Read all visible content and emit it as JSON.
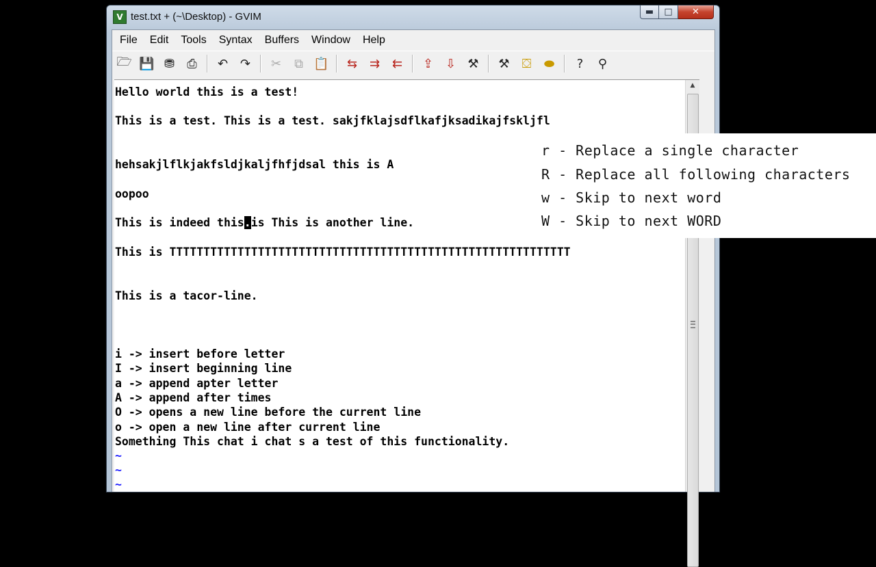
{
  "window": {
    "title": "test.txt + (~\\Desktop) - GVIM",
    "app_icon": "vim-icon",
    "controls": {
      "minimize": "▬",
      "maximize": "□",
      "close": "✕"
    }
  },
  "menu": [
    "File",
    "Edit",
    "Tools",
    "Syntax",
    "Buffers",
    "Window",
    "Help"
  ],
  "toolbar": [
    {
      "icon": "open-icon",
      "glyph": "🗁"
    },
    {
      "icon": "save-icon",
      "glyph": "💾"
    },
    {
      "icon": "save-all-icon",
      "glyph": "⛃"
    },
    {
      "icon": "print-icon",
      "glyph": "⎙"
    },
    {
      "icon": "undo-icon",
      "glyph": "↶"
    },
    {
      "icon": "redo-icon",
      "glyph": "↷"
    },
    {
      "icon": "cut-icon",
      "glyph": "✂"
    },
    {
      "icon": "copy-icon",
      "glyph": "⧉"
    },
    {
      "icon": "paste-icon",
      "glyph": "📋"
    },
    {
      "icon": "replace-icon",
      "glyph": "⇆"
    },
    {
      "icon": "find-next-icon",
      "glyph": "⇉"
    },
    {
      "icon": "find-prev-icon",
      "glyph": "⇇"
    },
    {
      "icon": "load-session-icon",
      "glyph": "⇪"
    },
    {
      "icon": "save-session-icon",
      "glyph": "⇩"
    },
    {
      "icon": "run-script-icon",
      "glyph": "⚒"
    },
    {
      "icon": "make-icon",
      "glyph": "⚒"
    },
    {
      "icon": "shell-icon",
      "glyph": "⛋"
    },
    {
      "icon": "tag-icon",
      "glyph": "⬬"
    },
    {
      "icon": "help-icon",
      "glyph": "?"
    },
    {
      "icon": "find-help-icon",
      "glyph": "⚲"
    }
  ],
  "editor": {
    "lines": [
      {
        "text": "Hello world this is a test!",
        "row": 0
      },
      {
        "text": "This is a test. This is a test. sakjfklajsdflkafjksadikajfskljfl",
        "row": 2
      },
      {
        "text": "hehsakjlflkjakfsldjkaljfhfjdsal this is A",
        "row": 5
      },
      {
        "text": "oopoo",
        "row": 7
      },
      {
        "before": "This is indeed this",
        "cursor": ".",
        "after": "is This is another line.",
        "row": 9
      },
      {
        "text": "This is TTTTTTTTTTTTTTTTTTTTTTTTTTTTTTTTTTTTTTTTTTTTTTTTTTTTTTTTTTT",
        "row": 11
      },
      {
        "text": "This is a tacor-line.",
        "row": 14
      },
      {
        "text": "i -> insert before letter",
        "row": 18
      },
      {
        "text": "I -> insert beginning line",
        "row": 19
      },
      {
        "text": "a -> append apter letter",
        "row": 20
      },
      {
        "text": "A -> append after times",
        "row": 21
      },
      {
        "text": "O -> opens a new line before the current line",
        "row": 22
      },
      {
        "text": "o -> open a new line after current line",
        "row": 23
      },
      {
        "text": "Something This chat i chat s a test of this functionality.",
        "row": 24
      }
    ],
    "tildes": [
      "~",
      "~",
      "~",
      "~"
    ]
  },
  "scrollbar": {
    "up_arrow": "▲"
  },
  "overlay": {
    "lines": [
      "r - Replace a single character",
      "R - Replace all following characters",
      "w - Skip to next word",
      "W - Skip to next WORD"
    ]
  }
}
